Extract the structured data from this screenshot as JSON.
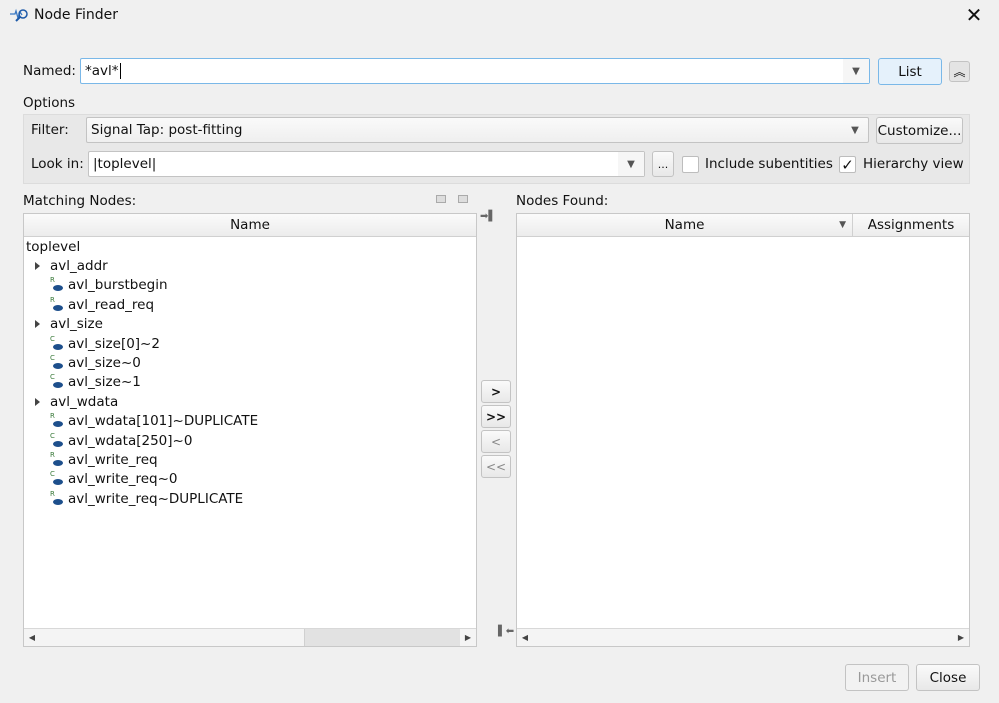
{
  "window": {
    "title": "Node Finder",
    "icon": "node-finder-icon",
    "close_icon": "close-icon"
  },
  "named": {
    "label": "Named:",
    "value": "*avl*",
    "list_button": "List",
    "collapse_icon": "double-chevron-up-icon"
  },
  "options": {
    "label": "Options",
    "filter_label": "Filter:",
    "filter_value": "Signal Tap: post-fitting",
    "customize_button": "Customize...",
    "lookin_label": "Look in:",
    "lookin_value": "|toplevel|",
    "browse_button": "...",
    "include_subentities_label": "Include subentities",
    "include_subentities_checked": false,
    "hierarchy_view_label": "Hierarchy view",
    "hierarchy_view_checked": true,
    "check_mark": "✓"
  },
  "matching": {
    "label": "Matching Nodes:",
    "column": "Name",
    "nodes": [
      {
        "label": "toplevel",
        "level": 0,
        "type": "root"
      },
      {
        "label": "avl_addr",
        "level": 1,
        "type": "group"
      },
      {
        "label": "avl_burstbegin",
        "level": 2,
        "type": "R"
      },
      {
        "label": "avl_read_req",
        "level": 2,
        "type": "R"
      },
      {
        "label": "avl_size",
        "level": 1,
        "type": "group"
      },
      {
        "label": "avl_size[0]~2",
        "level": 2,
        "type": "C"
      },
      {
        "label": "avl_size~0",
        "level": 2,
        "type": "C"
      },
      {
        "label": "avl_size~1",
        "level": 2,
        "type": "C"
      },
      {
        "label": "avl_wdata",
        "level": 1,
        "type": "group"
      },
      {
        "label": "avl_wdata[101]~DUPLICATE",
        "level": 2,
        "type": "R"
      },
      {
        "label": "avl_wdata[250]~0",
        "level": 2,
        "type": "C"
      },
      {
        "label": "avl_write_req",
        "level": 2,
        "type": "R"
      },
      {
        "label": "avl_write_req~0",
        "level": 2,
        "type": "C"
      },
      {
        "label": "avl_write_req~DUPLICATE",
        "level": 2,
        "type": "R"
      }
    ]
  },
  "transfer": {
    "add": ">",
    "add_all": ">>",
    "remove": "<",
    "remove_all": "<<"
  },
  "found": {
    "label": "Nodes Found:",
    "columns": [
      "Name",
      "Assignments"
    ]
  },
  "footer": {
    "insert": "Insert",
    "close": "Close"
  }
}
